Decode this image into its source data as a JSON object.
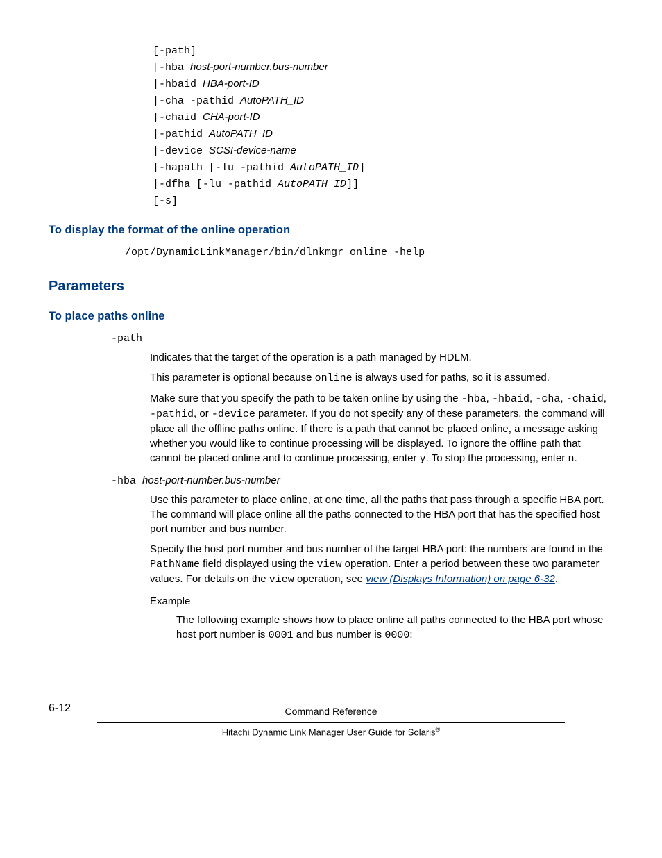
{
  "syntax": {
    "l1_a": "[-path]",
    "l2_a": "[-hba ",
    "l2_b": "host-port-number.bus-number",
    "l3_a": "|-hbaid ",
    "l3_b": "HBA-port-ID",
    "l4_a": "|-cha -pathid ",
    "l4_b": "AutoPATH_ID",
    "l5_a": "|-chaid ",
    "l5_b": "CHA-port-ID",
    "l6_a": "|-pathid ",
    "l6_b": "AutoPATH_ID",
    "l7_a": "|-device ",
    "l7_b": "SCSI-device-name",
    "l8_a": "|-hapath [-lu -pathid ",
    "l8_b": "AutoPATH_ID",
    "l8_c": "]",
    "l9_a": "|-dfha [-lu -pathid ",
    "l9_b": "AutoPATH_ID",
    "l9_c": "]]",
    "l10_a": "[-s]"
  },
  "heading_display_format": "To display the format of the online operation",
  "cmd_format": "/opt/DynamicLinkManager/bin/dlnkmgr online -help",
  "heading_parameters": "Parameters",
  "heading_place_paths": "To place paths online",
  "path": {
    "term": "-path",
    "p1": "Indicates that the target of the operation is a path managed by HDLM.",
    "p2_a": "This parameter is optional because ",
    "p2_b": "online",
    "p2_c": " is always used for paths, so it is assumed.",
    "p3_a": "Make sure that you specify the path to be taken online by using the ",
    "p3_b": "-hba",
    "p3_c": ", ",
    "p3_d": "-hbaid",
    "p3_e": ", ",
    "p3_f": "-cha",
    "p3_g": ", ",
    "p3_h": "-chaid",
    "p3_i": ", ",
    "p3_j": "-pathid",
    "p3_k": ", or ",
    "p3_l": "-device",
    "p3_m": " parameter. If you do not specify any of these parameters, the command will place all the offline paths online. If there is a path that cannot be placed online, a message asking whether you would like to continue processing will be displayed. To ignore the offline path that cannot be placed online and to continue processing, enter ",
    "p3_n": "y",
    "p3_o": ". To stop the processing, enter ",
    "p3_p": "n",
    "p3_q": "."
  },
  "hba": {
    "term_a": "-hba ",
    "term_b": "host-port-number",
    "term_c": ".",
    "term_d": "bus-number",
    "p1": "Use this parameter to place online, at one time, all the paths that pass through a specific HBA port. The command will place online all the paths connected to the HBA port that has the specified host port number and bus number.",
    "p2_a": "Specify the host port number and bus number of the target HBA port: the numbers are found in the ",
    "p2_b": "PathName",
    "p2_c": " field displayed using the ",
    "p2_d": "view",
    "p2_e": " operation. Enter a period between these two parameter values. For details on the ",
    "p2_f": "view",
    "p2_g": " operation, see ",
    "p2_link": "view (Displays Information) on page 6-32",
    "p2_h": ".",
    "example_label": "Example",
    "ex_a": "The following example shows how to place online all paths connected to the HBA port whose host port number is ",
    "ex_b": "0001",
    "ex_c": " and bus number is ",
    "ex_d": "0000",
    "ex_e": ":"
  },
  "footer": {
    "page": "6-12",
    "title": "Command Reference",
    "sub_a": "Hitachi Dynamic Link Manager User Guide for Solaris",
    "sub_b": "®"
  }
}
